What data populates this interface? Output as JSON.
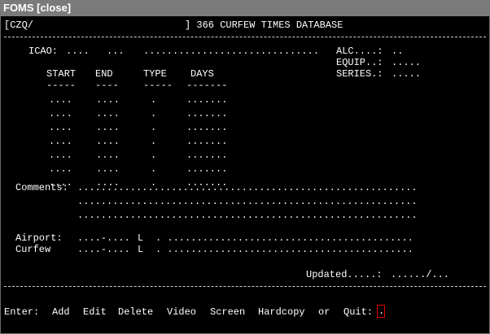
{
  "window": {
    "title": "FOMS [close]"
  },
  "header": {
    "prefix": "[CZQ/",
    "bracket_close": "] 366 CURFEW TIMES DATABASE"
  },
  "form": {
    "icao_label": "ICAO:",
    "icao_value": "....",
    "icao_code2": "...",
    "icao_name": "..............................",
    "alc_label": "ALC....:",
    "alc_value": "..",
    "equip_label": "EQUIP..:",
    "equip_value": ".....",
    "series_label": "SERIES.:",
    "series_value": ".....",
    "col_start": "START",
    "col_end": "END",
    "col_type": "TYPE",
    "col_days": "DAYS",
    "sep_start": "-----",
    "sep_end": "----",
    "sep_type": "-----",
    "sep_days": "-------",
    "rows": [
      {
        "start": "....",
        "end": "....",
        "type": ".",
        "days": "......."
      },
      {
        "start": "....",
        "end": "....",
        "type": ".",
        "days": "......."
      },
      {
        "start": "....",
        "end": "....",
        "type": ".",
        "days": "......."
      },
      {
        "start": "....",
        "end": "....",
        "type": ".",
        "days": "......."
      },
      {
        "start": "....",
        "end": "....",
        "type": ".",
        "days": "......."
      },
      {
        "start": "....",
        "end": "....",
        "type": ".",
        "days": "......."
      },
      {
        "start": "....",
        "end": "....",
        "type": ".",
        "days": "......."
      }
    ],
    "comments_label": "Comments:",
    "comments_lines": [
      "..........................................................",
      "..........................................................",
      ".........................................................."
    ],
    "airport_label": "Airport:",
    "airport_range": "....-....",
    "airport_flag": "L",
    "airport_text": ". ..........................................",
    "curfew_label": "Curfew",
    "curfew_range": "....-....",
    "curfew_flag": "L",
    "curfew_text": ". ..........................................",
    "updated_label": "Updated.....:",
    "updated_value": "....../..."
  },
  "command_bar": {
    "prompt": "Enter:",
    "add": "Add",
    "edit": "Edit",
    "delete": "Delete",
    "video": "Video",
    "screen": "Screen",
    "hardcopy": "Hardcopy",
    "or": "or",
    "quit": "Quit:",
    "input_value": "."
  }
}
